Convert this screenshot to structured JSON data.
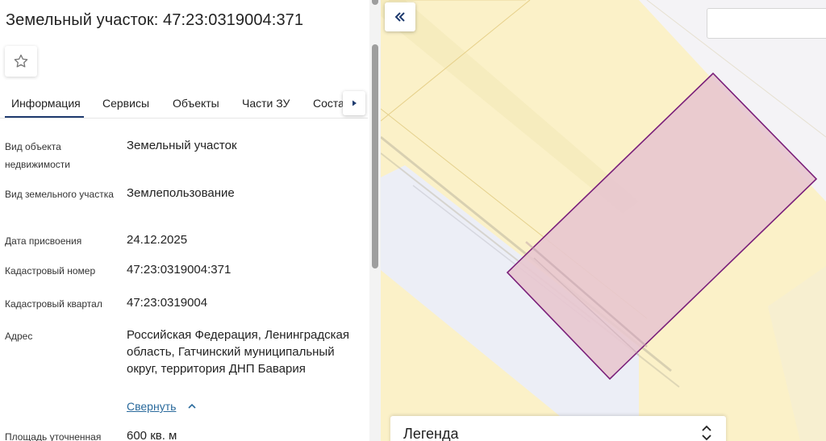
{
  "panel": {
    "title": "Земельный участок: 47:23:0319004:371",
    "tabs": [
      "Информация",
      "Сервисы",
      "Объекты",
      "Части ЗУ",
      "Соста"
    ],
    "rows": [
      {
        "label": "Вид объекта недвижимости",
        "value": "Земельный участок"
      },
      {
        "label": "Вид земельного участка",
        "value": "Землепользование"
      },
      {
        "label": "Дата присвоения",
        "value": "24.12.2025"
      },
      {
        "label": "Кадастровый номер",
        "value": "47:23:0319004:371"
      },
      {
        "label": "Кадастровый квартал",
        "value": "47:23:0319004"
      },
      {
        "label": "Адрес",
        "value": "Российская Федерация, Ленинградская область, Гатчинский муниципальный округ, территория ДНП Бавария"
      },
      {
        "label": "Площадь уточненная",
        "value": "600 кв. м"
      }
    ],
    "collapse_label": "Свернуть"
  },
  "map": {
    "legend_label": "Легенда",
    "parcel_fill": "#e8c6cf",
    "parcel_stroke": "#7a1f7a",
    "background": "#fbf1c8"
  },
  "colors": {
    "accent": "#1f3b6f",
    "link": "#2a6a9c"
  }
}
